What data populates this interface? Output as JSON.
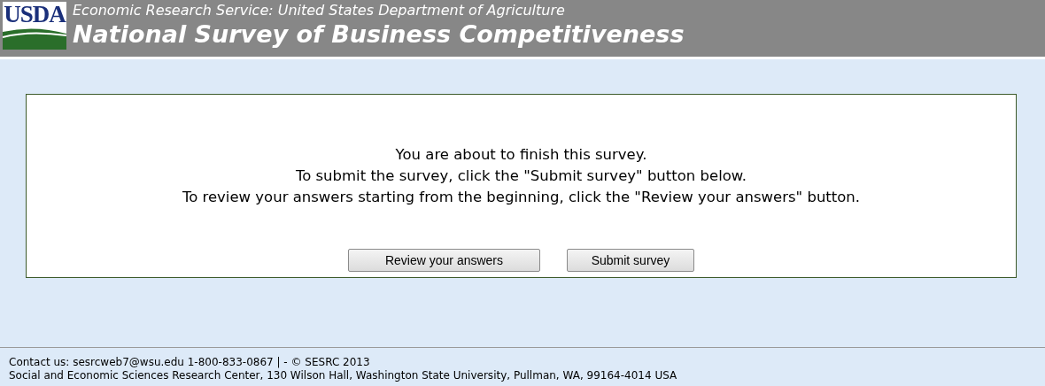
{
  "header": {
    "logo": "USDA",
    "agency": "Economic Research Service: United States Department of Agriculture",
    "title": "National Survey of Business Competitiveness"
  },
  "message": [
    "You are about to finish this survey.",
    "To submit the survey, click the \"Submit survey\" button below.",
    "To review your answers starting from the beginning, click the \"Review your answers\" button."
  ],
  "buttons": [
    "Review your answers",
    "Submit survey"
  ],
  "footer": {
    "contact": "Contact us: sesrcweb7@wsu.edu 1-800-833-0867 | - © SESRC 2013",
    "address": "Social and Economic Sciences Research Center, 130 Wilson Hall, Washington State University, Pullman, WA, 99164-4014 USA"
  }
}
